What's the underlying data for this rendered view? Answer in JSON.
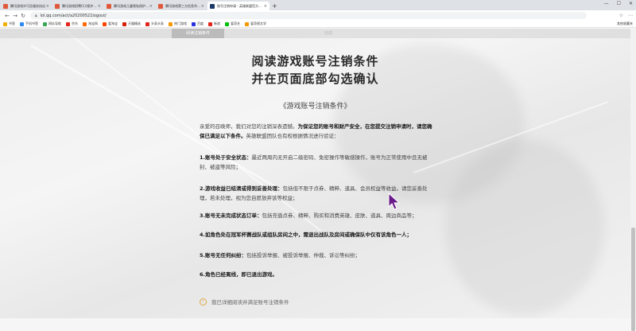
{
  "browser": {
    "tabs": [
      {
        "label": "腾讯游戏许可及服务协议",
        "color": "#e0593b",
        "active": false
      },
      {
        "label": "腾讯游戏招聘(1)(保护隐私)",
        "color": "#e0593b",
        "active": false
      },
      {
        "label": "腾讯游戏儿童隐私保护指引",
        "color": "#e0593b",
        "active": false
      },
      {
        "label": "腾讯游戏第三方信息共享清单",
        "color": "#e0593b",
        "active": false
      },
      {
        "label": "账号注销申请 - 英雄联盟官方网站",
        "color": "#1a3a6a",
        "active": true
      }
    ],
    "new_tab": "+",
    "url": "lol.qq.com/act/a20200521logout/",
    "bookmarks": [
      {
        "label": "书签",
        "color": "#f1b000"
      },
      {
        "label": "手机书签",
        "color": "#2c8af0"
      },
      {
        "label": "网址导航",
        "color": "#3aa757"
      },
      {
        "label": "京东",
        "color": "#e1251b"
      },
      {
        "label": "淘宝网",
        "color": "#ff6a00"
      },
      {
        "label": "爱淘宝",
        "color": "#ff4400"
      },
      {
        "label": "天猫精选",
        "color": "#d81e06"
      },
      {
        "label": "头条头条",
        "color": "#e1251b"
      },
      {
        "label": "热门游戏",
        "color": "#f39800"
      },
      {
        "label": "百度",
        "color": "#2932e1"
      },
      {
        "label": "新浪",
        "color": "#e1251b"
      },
      {
        "label": "爱奇艺",
        "color": "#00be06"
      },
      {
        "label": "爱奇视文学",
        "color": "#f39800"
      }
    ],
    "bookmarks_right": "其他收藏夹"
  },
  "site_nav": [
    "阅读注销条件",
    "",
    "",
    "",
    "完成"
  ],
  "title_line1": "阅读游戏账号注销条件",
  "title_line2": "并在页面底部勾选确认",
  "subtitle": "《游戏账号注销条件》",
  "intro_normal": "亲爱的召唤师，我们对您的注销深表遗憾。",
  "intro_bold": "为保证您的账号和财产安全，在您提交注销申请时，请您确保已满足以下条件。",
  "intro_tail": "英雄联盟团队也有权根据情况进行验证：",
  "sections": [
    {
      "heading": "1.账号处于安全状态：",
      "body": "最近两周内无开启二级密码、免密操作等敏感操作，账号为正常使用中且无被封、被盗等风险；"
    },
    {
      "heading": "2.游戏收益已结清或得到妥善处理：",
      "body": "包括但不限于点券、精粹、道具、会员权益等收益。请您妥善处理，若未处理，视为您自愿放弃该等权益；"
    },
    {
      "heading": "3.账号无未完成状态订单：",
      "body": "包括充值点券、精粹、购买和消费英雄、皮肤、道具、周边商品等；"
    },
    {
      "heading": "4.如角色处在冠军杯赛战队或组队房间之中，需退出战队及房间或确保队中仅有该角色一人；",
      "body": ""
    },
    {
      "heading": "5.账号无任何纠纷：",
      "body": "包括投诉举报、被投诉举报、仲裁、诉讼等纠纷；"
    },
    {
      "heading": "6.角色已经离线，即已退出游戏。",
      "body": ""
    }
  ],
  "agree_label": "我已详细阅读并满足账号注销条件",
  "colors": {
    "accent": "#e0a84a",
    "cursor": "#6b1a8a"
  }
}
